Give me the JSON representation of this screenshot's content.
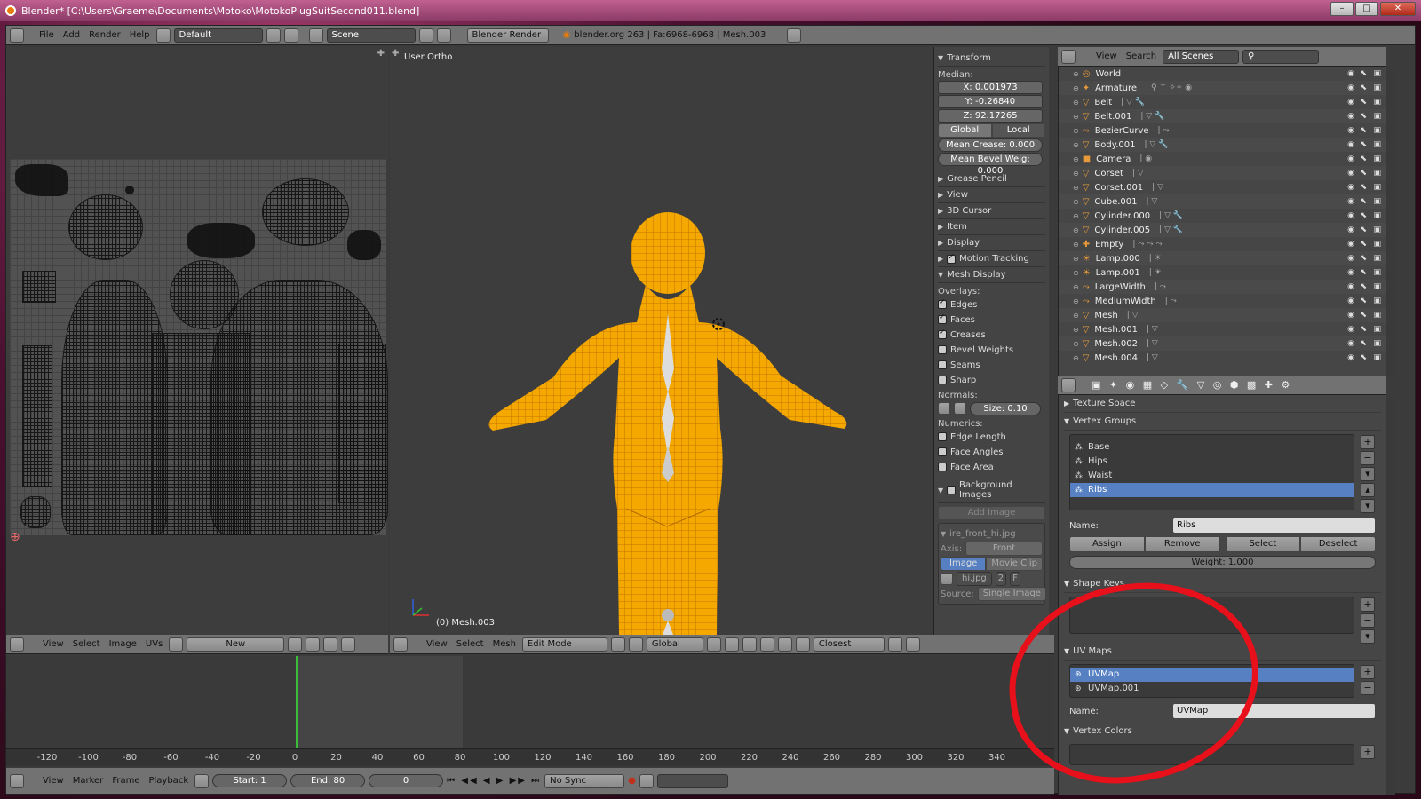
{
  "window": {
    "title": "Blender* [C:\\Users\\Graeme\\Documents\\Motoko\\MotokoPlugSuitSecond011.blend]",
    "controls": [
      "–",
      "□",
      "✕"
    ]
  },
  "info_header": {
    "menus": [
      "File",
      "Add",
      "Render",
      "Help"
    ],
    "layout": "Default",
    "scene": "Scene",
    "engine": "Blender Render",
    "stats": "blender.org 263 | Fa:6968-6968 | Mesh.003"
  },
  "viewport": {
    "label": "User Ortho",
    "object_label": "(0) Mesh.003",
    "header": {
      "menus": [
        "View",
        "Select",
        "Mesh"
      ],
      "mode": "Edit Mode",
      "orientation": "Global",
      "snap": "Closest"
    }
  },
  "uv_editor": {
    "header": {
      "menus": [
        "View",
        "Select",
        "Image",
        "UVs"
      ],
      "new_label": "New"
    }
  },
  "transform_panel": {
    "title": "Transform",
    "median_label": "Median:",
    "x": "X: 0.001973",
    "y": "Y: -0.26840",
    "z": "Z: 92.17265",
    "global_label": "Global",
    "local_label": "Local",
    "mean_crease": "Mean Crease: 0.000",
    "mean_bevel": "Mean Bevel Weig: 0.000",
    "collapsed": [
      "Grease Pencil",
      "View",
      "3D Cursor",
      "Item",
      "Display"
    ],
    "motion_tracking": "Motion Tracking",
    "mesh_display": "Mesh Display",
    "overlays_label": "Overlays:",
    "overlays": [
      {
        "label": "Edges",
        "checked": true
      },
      {
        "label": "Faces",
        "checked": true
      },
      {
        "label": "Creases",
        "checked": true
      },
      {
        "label": "Bevel Weights",
        "checked": false
      },
      {
        "label": "Seams",
        "checked": false
      },
      {
        "label": "Sharp",
        "checked": false
      }
    ],
    "normals_label": "Normals:",
    "normals_size": "Size: 0.10",
    "numerics_label": "Numerics:",
    "numerics": [
      {
        "label": "Edge Length",
        "checked": false
      },
      {
        "label": "Face Angles",
        "checked": false
      },
      {
        "label": "Face Area",
        "checked": false
      }
    ],
    "background_images": "Background Images",
    "add_image": "Add Image",
    "bg_image_name": "ire_front_hi.jpg",
    "axis_label": "Axis:",
    "axis_value": "Front",
    "image_tab": "Image",
    "movie_clip_tab": "Movie Clip",
    "image_file": "hi.jpg",
    "image_users": "2",
    "image_fake": "F",
    "source_label": "Source:",
    "source_value": "Single Image"
  },
  "outliner": {
    "menus": [
      "View",
      "Search"
    ],
    "filter": "All Scenes",
    "items": [
      {
        "name": "World",
        "icon": "◎",
        "extra": ""
      },
      {
        "name": "Armature",
        "icon": "✦",
        "extra": "| ⚲ ⚚ ✧✧ ◉"
      },
      {
        "name": "Belt",
        "icon": "▽",
        "extra": "| ▽ 🔧"
      },
      {
        "name": "Belt.001",
        "icon": "▽",
        "extra": "| ▽ 🔧"
      },
      {
        "name": "BezierCurve",
        "icon": "⤳",
        "extra": "| ⤳"
      },
      {
        "name": "Body.001",
        "icon": "▽",
        "extra": "| ▽ 🔧"
      },
      {
        "name": "Camera",
        "icon": "■",
        "extra": "| ◉"
      },
      {
        "name": "Corset",
        "icon": "▽",
        "extra": "| ▽"
      },
      {
        "name": "Corset.001",
        "icon": "▽",
        "extra": "| ▽"
      },
      {
        "name": "Cube.001",
        "icon": "▽",
        "extra": "| ▽"
      },
      {
        "name": "Cylinder.000",
        "icon": "▽",
        "extra": "| ▽ 🔧"
      },
      {
        "name": "Cylinder.005",
        "icon": "▽",
        "extra": "| ▽ 🔧"
      },
      {
        "name": "Empty",
        "icon": "✚",
        "extra": "| ⤳ ⤳ ⤳"
      },
      {
        "name": "Lamp.000",
        "icon": "☀",
        "extra": "| ☀"
      },
      {
        "name": "Lamp.001",
        "icon": "☀",
        "extra": "| ☀"
      },
      {
        "name": "LargeWidth",
        "icon": "⤳",
        "extra": "| ⤳"
      },
      {
        "name": "MediumWidth",
        "icon": "⤳",
        "extra": "| ⤳"
      },
      {
        "name": "Mesh",
        "icon": "▽",
        "extra": "| ▽"
      },
      {
        "name": "Mesh.001",
        "icon": "▽",
        "extra": "| ▽"
      },
      {
        "name": "Mesh.002",
        "icon": "▽",
        "extra": "| ▽"
      },
      {
        "name": "Mesh.004",
        "icon": "▽",
        "extra": "| ▽"
      }
    ]
  },
  "properties": {
    "texture_space": "Texture Space",
    "vertex_groups": {
      "title": "Vertex Groups",
      "items": [
        "Base",
        "Hips",
        "Waist",
        "Ribs"
      ],
      "selected": 3,
      "name_label": "Name:",
      "name_value": "Ribs",
      "buttons": [
        "Assign",
        "Remove",
        "Select",
        "Deselect"
      ],
      "weight": "Weight: 1.000"
    },
    "shape_keys": {
      "title": "Shape Keys"
    },
    "uv_maps": {
      "title": "UV Maps",
      "items": [
        "UVMap",
        "UVMap.001"
      ],
      "selected": 0,
      "name_label": "Name:",
      "name_value": "UVMap"
    },
    "vertex_colors": {
      "title": "Vertex Colors"
    }
  },
  "timeline": {
    "ticks": [
      "-120",
      "-100",
      "-80",
      "-60",
      "-40",
      "-20",
      "0",
      "20",
      "40",
      "60",
      "80",
      "100",
      "120",
      "140",
      "160",
      "180",
      "200",
      "220",
      "240",
      "260",
      "280",
      "300",
      "320",
      "340"
    ],
    "menus": [
      "View",
      "Marker",
      "Frame",
      "Playback"
    ],
    "start": "Start: 1",
    "end": "End: 80",
    "current": "0",
    "sync": "No Sync"
  },
  "colors": {
    "selection_blue": "#5680c2",
    "mesh_orange": "#f5a800",
    "annotation_red": "#e8101a",
    "frame_marker_green": "#3bbd3b"
  }
}
